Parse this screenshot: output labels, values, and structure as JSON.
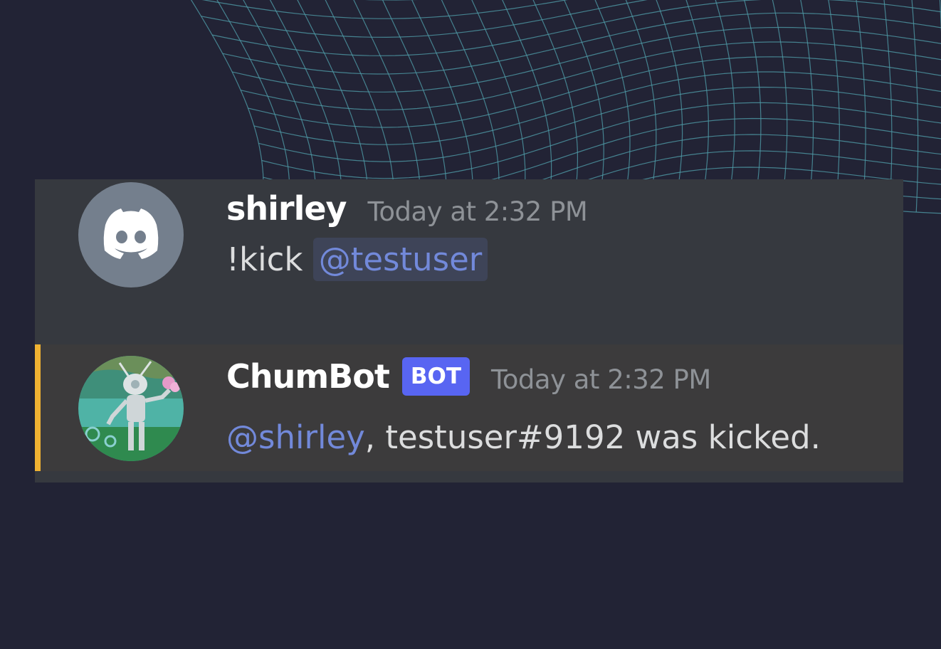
{
  "messages": {
    "user": {
      "username": "shirley",
      "timestamp": "Today at 2:32 PM",
      "command": "!kick",
      "mention": "@testuser",
      "avatar_icon": "discord-logo-icon"
    },
    "bot": {
      "username": "ChumBot",
      "tag": "BOT",
      "timestamp": "Today at 2:32 PM",
      "mention": "@shirley",
      "text": ", testuser#9192 was kicked.",
      "accent_color": "#f0b232"
    }
  },
  "colors": {
    "background": "#222335",
    "mesh": "#4f9aa6",
    "mention": "#7289da",
    "bot_tag": "#5865f2"
  }
}
